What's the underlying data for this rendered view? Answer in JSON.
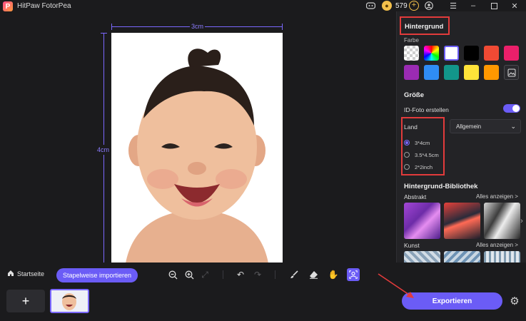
{
  "app": {
    "title": "HitPaw FotorPea",
    "logo_letter": "P"
  },
  "titlebar": {
    "coins": "579"
  },
  "canvas": {
    "width_label": "3cm",
    "height_label": "4cm"
  },
  "panel": {
    "background_title": "Hintergrund",
    "color_label": "Farbe",
    "swatches": [
      "transparent",
      "rainbow",
      "#ffffff",
      "#000000",
      "#f04a34",
      "#ea1f6a",
      "#9b2bb3",
      "#2f8df5",
      "#12968a",
      "#ffe339",
      "#ff9800",
      "custom"
    ],
    "size_title": "Größe",
    "id_photo_label": "ID-Foto erstellen",
    "country_label": "Land",
    "country_select": "Allgemein",
    "sizes": [
      {
        "label": "3*4cm",
        "selected": true
      },
      {
        "label": "3.5*4.5cm",
        "selected": false
      },
      {
        "label": "2*2inch",
        "selected": false
      }
    ],
    "library_title": "Hintergrund-Bibliothek",
    "categories": [
      {
        "name": "Abstrakt",
        "more": "Alles anzeigen >"
      },
      {
        "name": "Kunst",
        "more": "Alles anzeigen >"
      }
    ]
  },
  "toolbar": {
    "home_label": "Startseite",
    "batch_label": "Stapelweise importieren"
  },
  "bottom": {
    "add_label": "+",
    "export_label": "Exportieren"
  },
  "colors": {
    "accent": "#6b5cf6",
    "highlight": "#e23b3b"
  }
}
